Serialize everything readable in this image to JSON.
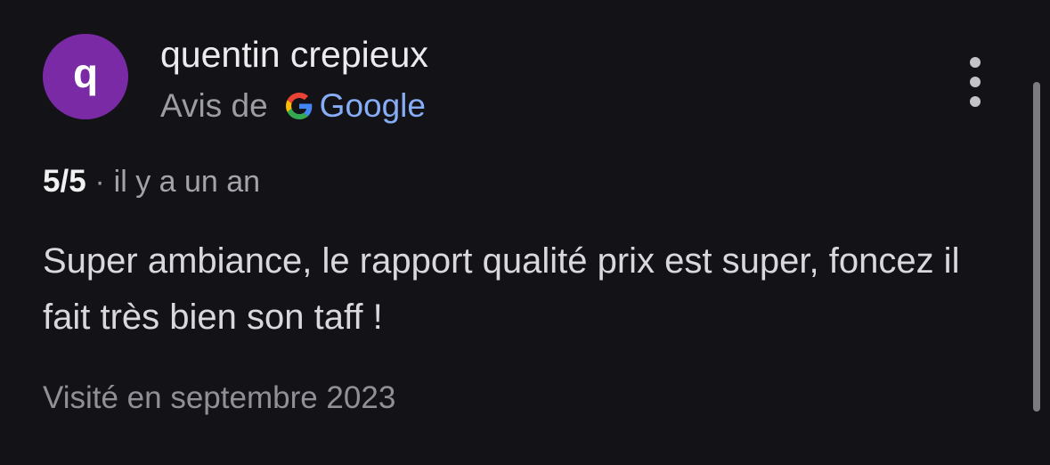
{
  "review": {
    "author": {
      "initial": "q",
      "name": "quentin crepieux",
      "avatar_color": "#7b2aa6"
    },
    "source": {
      "prefix": "Avis de",
      "provider": "Google",
      "provider_color": "#86adf5",
      "logo_icon": "google-g-icon"
    },
    "rating": "5/5",
    "separator": "·",
    "time_ago": "il y a un an",
    "text": "Super ambiance, le rapport qualité prix est super, foncez il fait très bien son taff !",
    "visited": "Visité en septembre 2023"
  },
  "menu": {
    "icon": "more-vertical-icon"
  },
  "colors": {
    "background": "#131317",
    "text_primary": "#ececef",
    "text_secondary": "#9c9ca3"
  }
}
